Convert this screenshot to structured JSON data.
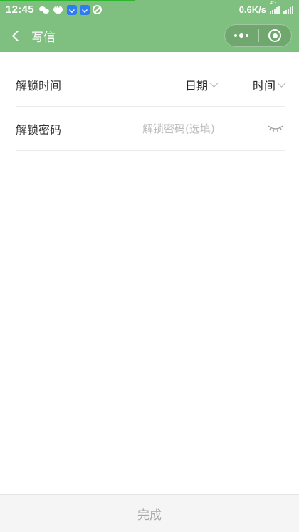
{
  "status_bar": {
    "time": "12:45",
    "net_speed": "0.6K/s",
    "network_tag": "4G",
    "icons": [
      "wechat-icon",
      "chat-bubble-icon",
      "download-icon",
      "download-icon",
      "blocked-icon",
      "signal-icon",
      "signal-icon"
    ]
  },
  "nav": {
    "back_icon": "chevron-left-icon",
    "title": "写信",
    "capsule": {
      "more_icon": "more-dots-icon",
      "close_icon": "target-ring-icon"
    }
  },
  "form": {
    "unlock_time": {
      "label": "解锁时间",
      "date_picker": "日期",
      "time_picker": "时间"
    },
    "unlock_password": {
      "label": "解锁密码",
      "placeholder": "解锁密码(选填)",
      "value": "",
      "eye_icon": "eye-closed-icon"
    }
  },
  "footer": {
    "done_label": "完成"
  },
  "colors": {
    "header_bg": "#7fbf7f",
    "progress": "#2fb52f",
    "divider": "#ececec",
    "placeholder": "#bdbdbd",
    "done_text": "#a8a8a8",
    "footer_bg": "#f5f5f5"
  }
}
